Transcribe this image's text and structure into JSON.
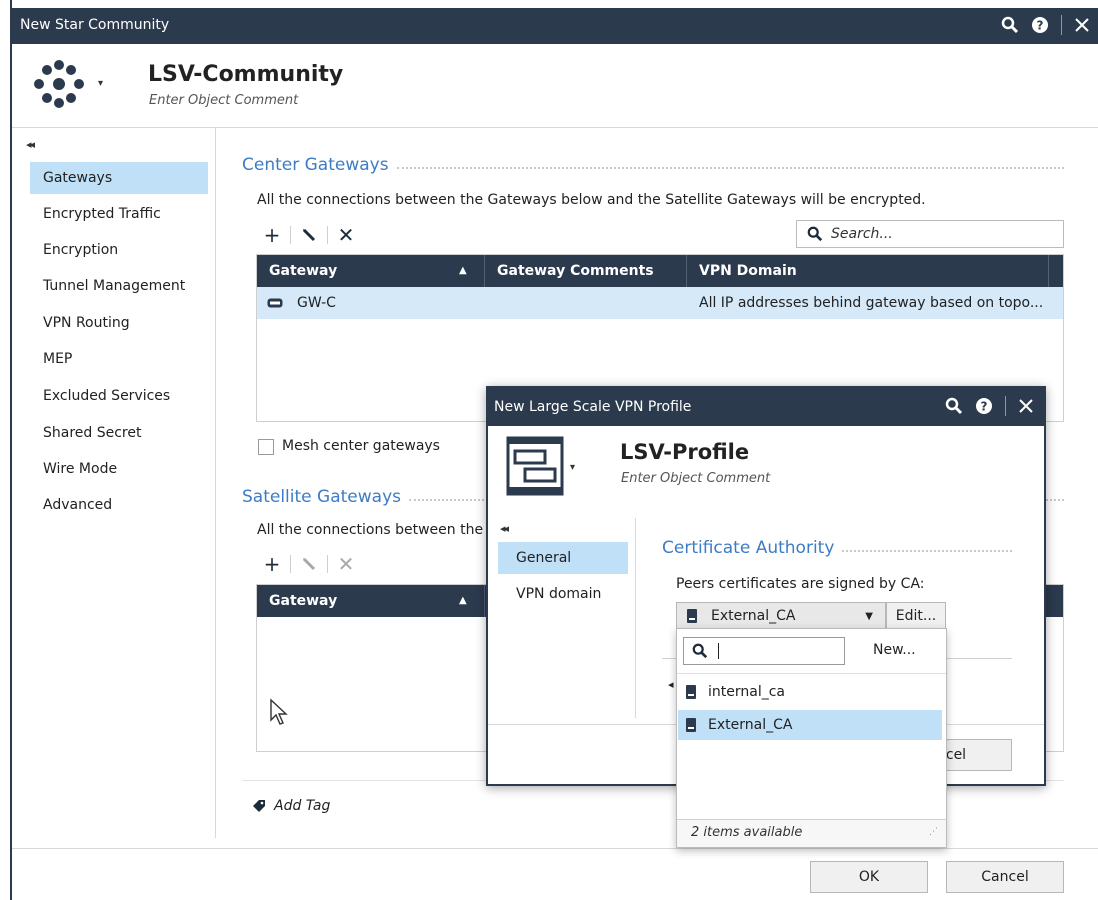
{
  "window": {
    "title": "New Star Community"
  },
  "header": {
    "name": "LSV-Community",
    "comment": "Enter Object Comment"
  },
  "sidebar": {
    "items": [
      {
        "label": "Gateways"
      },
      {
        "label": "Encrypted Traffic"
      },
      {
        "label": "Encryption"
      },
      {
        "label": "Tunnel Management"
      },
      {
        "label": "VPN Routing"
      },
      {
        "label": "MEP"
      },
      {
        "label": "Excluded Services"
      },
      {
        "label": "Shared Secret"
      },
      {
        "label": "Wire Mode"
      },
      {
        "label": "Advanced"
      }
    ],
    "selected": "Gateways"
  },
  "center": {
    "title": "Center Gateways",
    "description": "All the connections between the Gateways below and the Satellite Gateways will be encrypted.",
    "search_placeholder": "Search...",
    "columns": [
      "Gateway",
      "Gateway Comments",
      "VPN Domain"
    ],
    "rows": [
      {
        "gateway": "GW-C",
        "comments": "",
        "vpn_domain": "All IP addresses behind gateway based on topo..."
      }
    ],
    "mesh_label": "Mesh center gateways",
    "mesh_checked": false
  },
  "satellite": {
    "title": "Satellite Gateways",
    "description": "All the connections between the",
    "columns": [
      "Gateway"
    ]
  },
  "add_tag": "Add Tag",
  "footer": {
    "ok": "OK",
    "cancel": "Cancel"
  },
  "dialog": {
    "title": "New Large Scale VPN Profile",
    "name": "LSV-Profile",
    "comment": "Enter Object Comment",
    "nav": [
      {
        "label": "General"
      },
      {
        "label": "VPN domain"
      }
    ],
    "selected_nav": "General",
    "section_title": "Certificate Authority",
    "ca_label": "Peers certificates are signed by CA:",
    "ca_selected": "External_CA",
    "edit_button": "Edit...",
    "cancel_partial": "ncel"
  },
  "dropdown": {
    "search_value": "",
    "new_button": "New...",
    "items": [
      {
        "label": "internal_ca"
      },
      {
        "label": "External_CA"
      }
    ],
    "selected": "External_CA",
    "footer": "2 items available"
  },
  "colors": {
    "titlebar": "#2b3a4d",
    "accent": "#3d7cc4",
    "selection": "#bfe0f7"
  }
}
